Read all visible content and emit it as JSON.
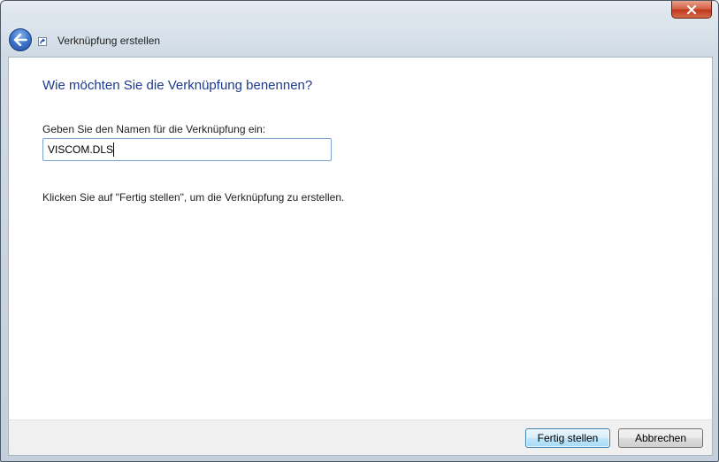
{
  "window": {
    "title": "Verknüpfung erstellen"
  },
  "icons": {
    "back": "back-arrow-icon",
    "shortcut": "shortcut-icon",
    "close": "close-icon"
  },
  "colors": {
    "heading": "#1c3b8c",
    "input_border": "#7da2ce",
    "close_button": "#c0391d"
  },
  "content": {
    "heading": "Wie möchten Sie die Verknüpfung benennen?",
    "name_label": "Geben Sie den Namen für die Verknüpfung ein:",
    "name_value": "VISCOM.DLS",
    "hint": "Klicken Sie auf \"Fertig stellen\", um die Verknüpfung zu erstellen."
  },
  "footer": {
    "finish_label": "Fertig stellen",
    "cancel_label": "Abbrechen"
  }
}
